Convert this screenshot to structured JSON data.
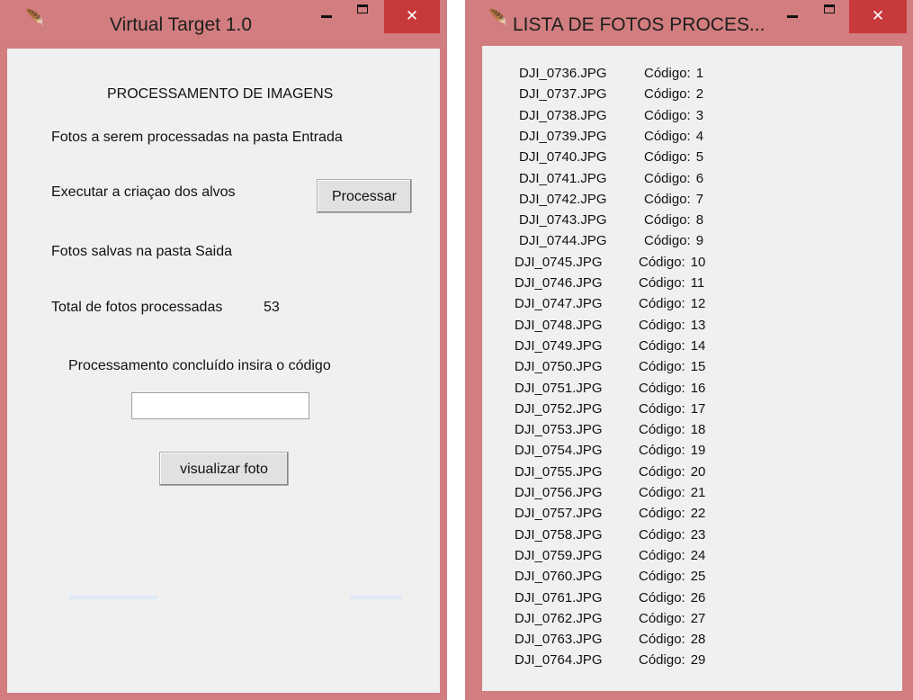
{
  "window1": {
    "title": "Virtual Target 1.0",
    "close_glyph": "✕",
    "heading": "PROCESSAMENTO DE  IMAGENS",
    "line_input": "Fotos a serem processadas na pasta Entrada",
    "line_execute": "Executar a criaçao dos alvos",
    "process_button": "Processar",
    "line_saved": "Fotos salvas na pasta Saida",
    "total_label": "Total de fotos processadas",
    "total_value": "53",
    "done_message": "Processamento concluído insira o código",
    "code_input_value": "",
    "view_button": "visualizar foto"
  },
  "window2": {
    "title": "LISTA DE FOTOS PROCES...",
    "close_glyph": "✕",
    "code_prefix": "Código:",
    "files": [
      {
        "file": "DJI_0736.JPG",
        "code": "1"
      },
      {
        "file": "DJI_0737.JPG",
        "code": "2"
      },
      {
        "file": "DJI_0738.JPG",
        "code": "3"
      },
      {
        "file": "DJI_0739.JPG",
        "code": "4"
      },
      {
        "file": "DJI_0740.JPG",
        "code": "5"
      },
      {
        "file": "DJI_0741.JPG",
        "code": "6"
      },
      {
        "file": "DJI_0742.JPG",
        "code": "7"
      },
      {
        "file": "DJI_0743.JPG",
        "code": "8"
      },
      {
        "file": "DJI_0744.JPG",
        "code": "9"
      },
      {
        "file": "DJI_0745.JPG",
        "code": "10"
      },
      {
        "file": "DJI_0746.JPG",
        "code": "11"
      },
      {
        "file": "DJI_0747.JPG",
        "code": "12"
      },
      {
        "file": "DJI_0748.JPG",
        "code": "13"
      },
      {
        "file": "DJI_0749.JPG",
        "code": "14"
      },
      {
        "file": "DJI_0750.JPG",
        "code": "15"
      },
      {
        "file": "DJI_0751.JPG",
        "code": "16"
      },
      {
        "file": "DJI_0752.JPG",
        "code": "17"
      },
      {
        "file": "DJI_0753.JPG",
        "code": "18"
      },
      {
        "file": "DJI_0754.JPG",
        "code": "19"
      },
      {
        "file": "DJI_0755.JPG",
        "code": "20"
      },
      {
        "file": "DJI_0756.JPG",
        "code": "21"
      },
      {
        "file": "DJI_0757.JPG",
        "code": "22"
      },
      {
        "file": "DJI_0758.JPG",
        "code": "23"
      },
      {
        "file": "DJI_0759.JPG",
        "code": "24"
      },
      {
        "file": "DJI_0760.JPG",
        "code": "25"
      },
      {
        "file": "DJI_0761.JPG",
        "code": "26"
      },
      {
        "file": "DJI_0762.JPG",
        "code": "27"
      },
      {
        "file": "DJI_0763.JPG",
        "code": "28"
      },
      {
        "file": "DJI_0764.JPG",
        "code": "29"
      }
    ]
  },
  "colors": {
    "frame": "#d27d7f",
    "close_button": "#c8393c",
    "client": "#f0f0f0"
  },
  "icons": {
    "app_icon": "feather-icon"
  }
}
